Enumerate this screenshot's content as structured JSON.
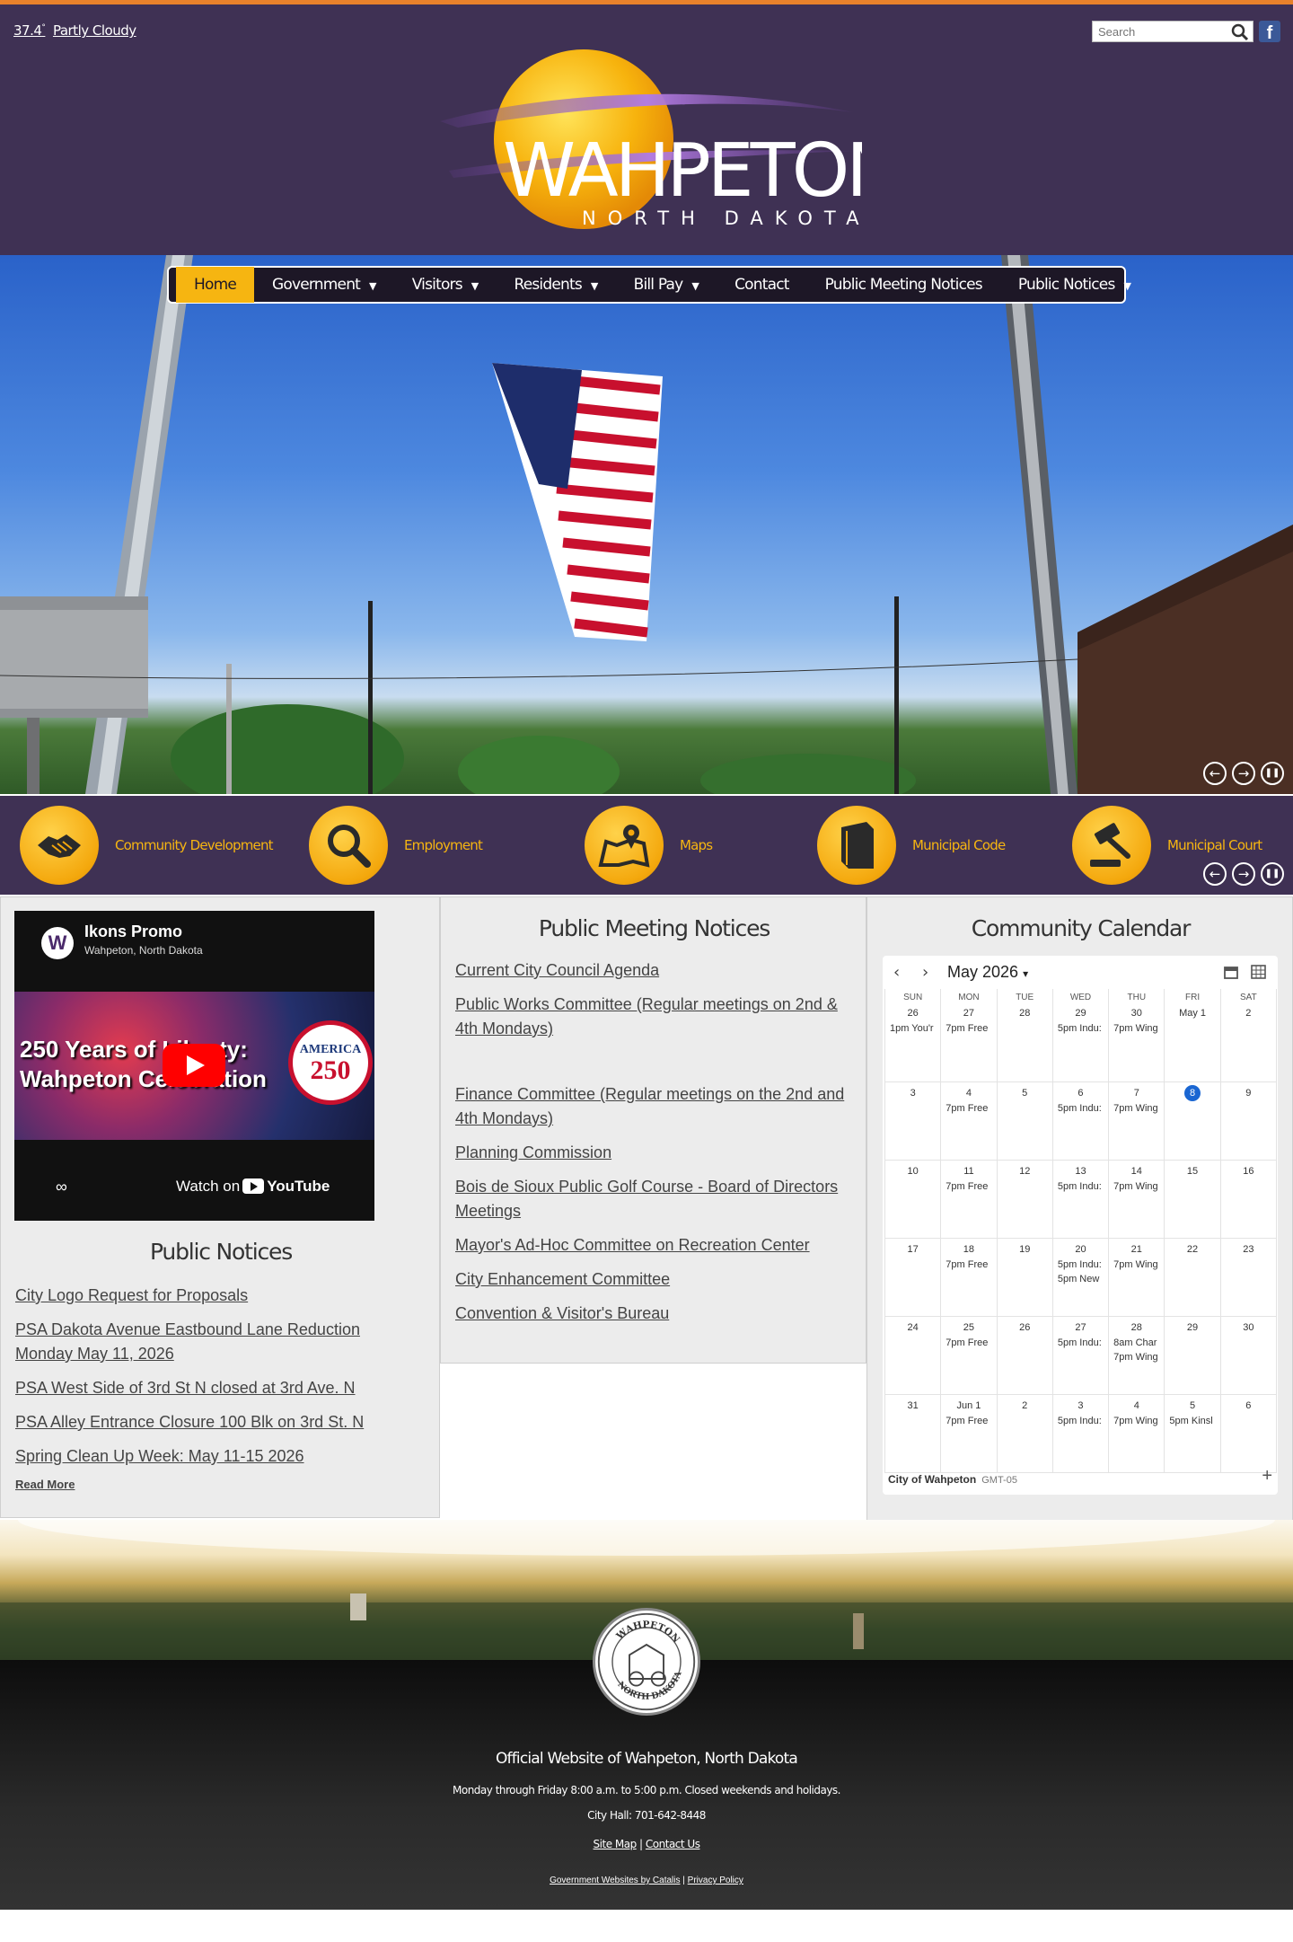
{
  "header": {
    "weather_temp": "37.4",
    "weather_degree": "°",
    "weather_condition": "Partly Cloudy",
    "search_placeholder": "Search",
    "logo_name": "WAHPETON",
    "logo_state": "NORTH DAKOTA"
  },
  "nav": [
    {
      "label": "Home",
      "dropdown": false
    },
    {
      "label": "Government",
      "dropdown": true
    },
    {
      "label": "Visitors",
      "dropdown": true
    },
    {
      "label": "Residents",
      "dropdown": true
    },
    {
      "label": "Bill Pay",
      "dropdown": true
    },
    {
      "label": "Contact",
      "dropdown": false
    },
    {
      "label": "Public Meeting Notices",
      "dropdown": false
    },
    {
      "label": "Public Notices",
      "dropdown": true
    }
  ],
  "nav_caret": "▼",
  "slider_controls": {
    "prev": "←",
    "next": "→",
    "pause": "❚❚"
  },
  "quick_links": [
    {
      "label": "Community Development",
      "icon": "handshake-icon"
    },
    {
      "label": "Employment",
      "icon": "magnifier-icon"
    },
    {
      "label": "Maps",
      "icon": "map-pin-icon"
    },
    {
      "label": "Municipal Code",
      "icon": "book-icon"
    },
    {
      "label": "Municipal Court",
      "icon": "gavel-icon"
    }
  ],
  "video": {
    "channel_initial": "W",
    "title": "Ikons Promo",
    "subtitle": "Wahpeton, North Dakota",
    "thumb_line1": "250 Years of Liberty:",
    "thumb_line2": "Wahpeton Celebration",
    "badge_word": "AMERICA",
    "badge_number": "250",
    "watch_on": "Watch on",
    "youtube": "YouTube"
  },
  "public_notices": {
    "title": "Public Notices",
    "items": [
      "City Logo Request for Proposals",
      "PSA Dakota Avenue Eastbound Lane Reduction Monday May 11, 2026",
      "PSA West Side of 3rd St N closed at 3rd Ave. N",
      "PSA Alley Entrance Closure 100 Blk on 3rd St. N",
      "Spring Clean Up Week: May 11-15 2026"
    ],
    "read_more": "Read More"
  },
  "meeting_notices": {
    "title": "Public Meeting Notices",
    "items": [
      "Current City Council Agenda",
      "Public Works Committee (Regular meetings on 2nd & 4th Mondays)",
      "Finance Committee (Regular meetings on the 2nd and 4th Mondays)",
      "Planning Commission",
      "Bois de Sioux Public Golf Course - Board of Directors Meetings",
      "Mayor's Ad-Hoc Committee on Recreation Center",
      "City Enhancement Committee",
      "Convention & Visitor's Bureau"
    ]
  },
  "calendar": {
    "title": "Community Calendar",
    "month": "May 2026",
    "prev": "‹",
    "next": "›",
    "dropdown_caret": "▾",
    "weekdays": [
      "SUN",
      "MON",
      "TUE",
      "WED",
      "THU",
      "FRI",
      "SAT"
    ],
    "weeks": [
      [
        {
          "n": "26",
          "ev": [
            "1pm You'r"
          ]
        },
        {
          "n": "27",
          "ev": [
            "7pm Free"
          ]
        },
        {
          "n": "28",
          "ev": []
        },
        {
          "n": "29",
          "ev": [
            "5pm Indu:"
          ]
        },
        {
          "n": "30",
          "ev": [
            "7pm Wing"
          ]
        },
        {
          "n": "May 1",
          "ev": []
        },
        {
          "n": "2",
          "ev": []
        }
      ],
      [
        {
          "n": "3",
          "ev": []
        },
        {
          "n": "4",
          "ev": [
            "7pm Free"
          ]
        },
        {
          "n": "5",
          "ev": []
        },
        {
          "n": "6",
          "ev": [
            "5pm Indu:"
          ]
        },
        {
          "n": "7",
          "ev": [
            "7pm Wing"
          ]
        },
        {
          "n": "8",
          "ev": [],
          "today": true
        },
        {
          "n": "9",
          "ev": []
        }
      ],
      [
        {
          "n": "10",
          "ev": []
        },
        {
          "n": "11",
          "ev": [
            "7pm Free"
          ]
        },
        {
          "n": "12",
          "ev": []
        },
        {
          "n": "13",
          "ev": [
            "5pm Indu:"
          ]
        },
        {
          "n": "14",
          "ev": [
            "7pm Wing"
          ]
        },
        {
          "n": "15",
          "ev": []
        },
        {
          "n": "16",
          "ev": []
        }
      ],
      [
        {
          "n": "17",
          "ev": []
        },
        {
          "n": "18",
          "ev": [
            "7pm Free"
          ]
        },
        {
          "n": "19",
          "ev": []
        },
        {
          "n": "20",
          "ev": [
            "5pm Indu:",
            "5pm New"
          ]
        },
        {
          "n": "21",
          "ev": [
            "7pm Wing"
          ]
        },
        {
          "n": "22",
          "ev": []
        },
        {
          "n": "23",
          "ev": []
        }
      ],
      [
        {
          "n": "24",
          "ev": []
        },
        {
          "n": "25",
          "ev": [
            "7pm Free"
          ]
        },
        {
          "n": "26",
          "ev": []
        },
        {
          "n": "27",
          "ev": [
            "5pm Indu:"
          ]
        },
        {
          "n": "28",
          "ev": [
            "8am Char",
            "7pm Wing"
          ]
        },
        {
          "n": "29",
          "ev": []
        },
        {
          "n": "30",
          "ev": []
        }
      ],
      [
        {
          "n": "31",
          "ev": []
        },
        {
          "n": "Jun 1",
          "ev": [
            "7pm Free"
          ]
        },
        {
          "n": "2",
          "ev": []
        },
        {
          "n": "3",
          "ev": [
            "5pm Indu:"
          ]
        },
        {
          "n": "4",
          "ev": [
            "7pm Wing"
          ]
        },
        {
          "n": "5",
          "ev": [
            "5pm Kinsl"
          ]
        },
        {
          "n": "6",
          "ev": []
        }
      ]
    ],
    "footer_name": "City of Wahpeton",
    "timezone": "GMT-05",
    "add": "+"
  },
  "footer": {
    "seal_top": "WAHPETON",
    "seal_bottom": "NORTH DAKOTA",
    "title": "Official Website of Wahpeton, North Dakota",
    "hours": "Monday through Friday 8:00 a.m. to 5:00 p.m. Closed weekends and holidays.",
    "phone": "City Hall: 701-642-8448",
    "site_map": "Site Map",
    "separator": "|",
    "contact_us": "Contact Us",
    "credit": "Government Websites by Catalis",
    "privacy": "Privacy Policy"
  },
  "colors": {
    "brand_purple": "#3f3154",
    "accent_gold": "#f6b511",
    "top_border": "#e8812b"
  }
}
